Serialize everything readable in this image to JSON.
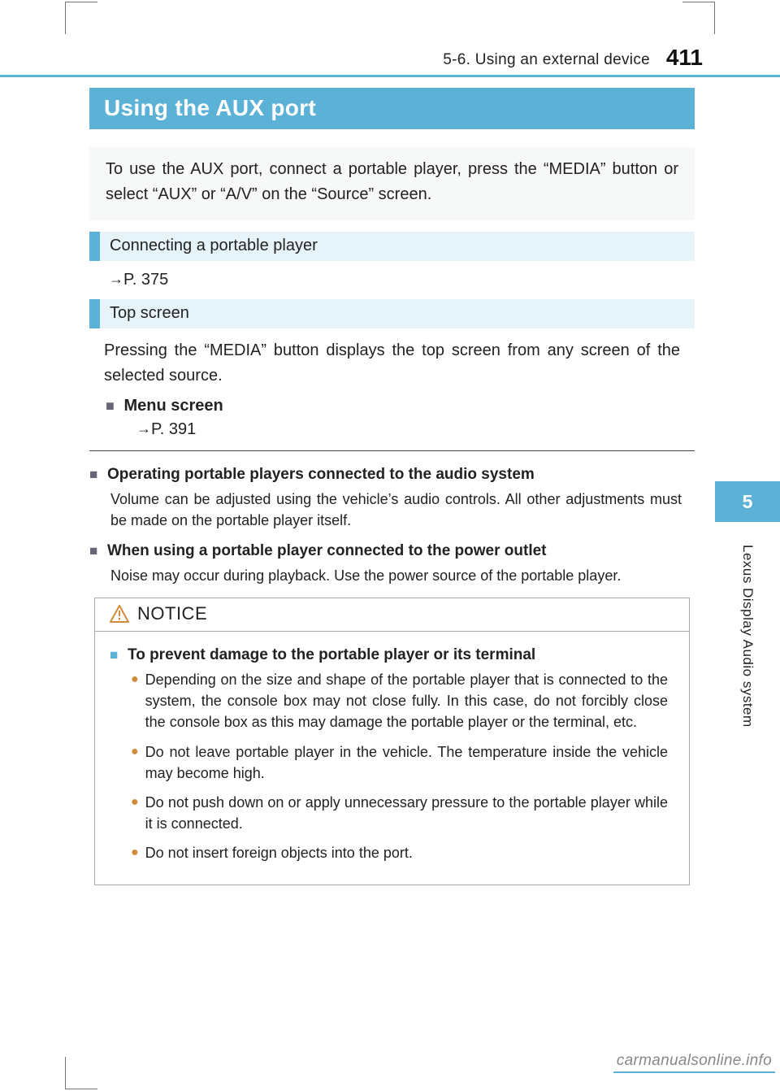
{
  "header": {
    "section_path": "5-6. Using an external device",
    "page_number": "411"
  },
  "title": "Using the AUX port",
  "intro": "To use the AUX port, connect a portable player, press the “MEDIA” button or select “AUX” or “A/V” on the “Source” screen.",
  "sections": {
    "connecting": {
      "heading": "Connecting a portable player",
      "page_ref": "P. 375"
    },
    "top_screen": {
      "heading": "Top screen",
      "body": "Pressing the “MEDIA” button displays the top screen from any screen of the selected source.",
      "menu_label": "Menu screen",
      "menu_ref": "P. 391"
    }
  },
  "notes": {
    "operating": {
      "title": "Operating portable players connected to the audio system",
      "body": "Volume can be adjusted using the vehicle’s audio controls. All other adjustments must be made on the portable player itself."
    },
    "power_outlet": {
      "title": "When using a portable player connected to the power outlet",
      "body": "Noise may occur during playback. Use the power source of the portable player."
    }
  },
  "notice": {
    "label": "NOTICE",
    "heading": "To prevent damage to the portable player or its terminal",
    "bullets": [
      "Depending on the size and shape of the portable player that is connected to the system, the console box may not close fully. In this case, do not forcibly close the console box as this may damage the portable player or the terminal, etc.",
      "Do not leave portable player in the vehicle. The temperature inside the vehicle may become high.",
      "Do not push down on or apply unnecessary pressure to the portable player while it is connected.",
      "Do not insert foreign objects into the port."
    ]
  },
  "side_tab": {
    "number": "5",
    "label": "Lexus Display Audio system"
  },
  "footer": "carmanualsonline.info",
  "glyphs": {
    "arrow": "→",
    "square": "■",
    "bullet": "●"
  }
}
